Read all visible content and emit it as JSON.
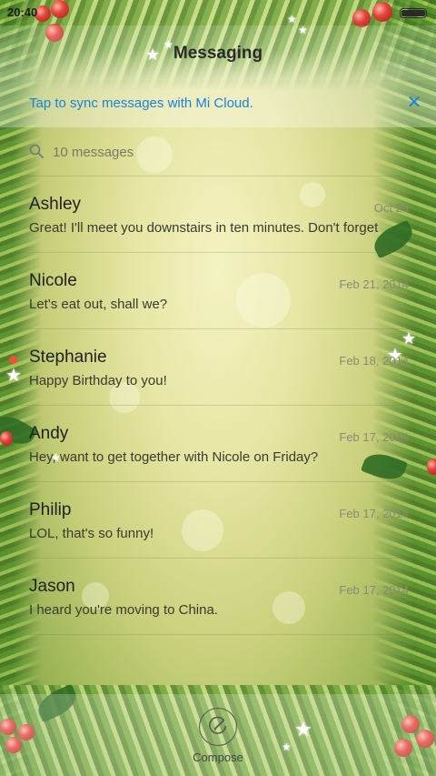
{
  "status_bar": {
    "time": "20:40",
    "icons": [
      "battery-icon"
    ]
  },
  "header": {
    "title": "Messaging"
  },
  "sync_banner": {
    "text": "Tap to sync messages with Mi Cloud.",
    "close_icon": "close-icon"
  },
  "search": {
    "placeholder": "10 messages",
    "icon": "search-icon"
  },
  "conversations": [
    {
      "name": "Ashley",
      "date": "Oct 29",
      "preview": "Great! I'll meet you downstairs in ten minutes. Don't forget",
      "unread": false
    },
    {
      "name": "Nicole",
      "date": "Feb 21, 2014",
      "preview": "Let's eat out, shall we?",
      "unread": false
    },
    {
      "name": "Stephanie",
      "date": "Feb 18, 2014",
      "preview": "Happy Birthday to you!",
      "unread": true
    },
    {
      "name": "Andy",
      "date": "Feb 17, 2014",
      "preview": "Hey, want to get together with Nicole on Friday?",
      "unread": false
    },
    {
      "name": "Philip",
      "date": "Feb 17, 2014",
      "preview": "LOL, that's so funny!",
      "unread": false
    },
    {
      "name": "Jason",
      "date": "Feb 17, 2014",
      "preview": "I heard you're moving to China.",
      "unread": false
    }
  ],
  "bottom_bar": {
    "compose_label": "Compose",
    "compose_icon": "compose-icon"
  },
  "colors": {
    "accent": "#1d82d6",
    "unread": "#f0503a",
    "text": "#1f1f1f"
  }
}
